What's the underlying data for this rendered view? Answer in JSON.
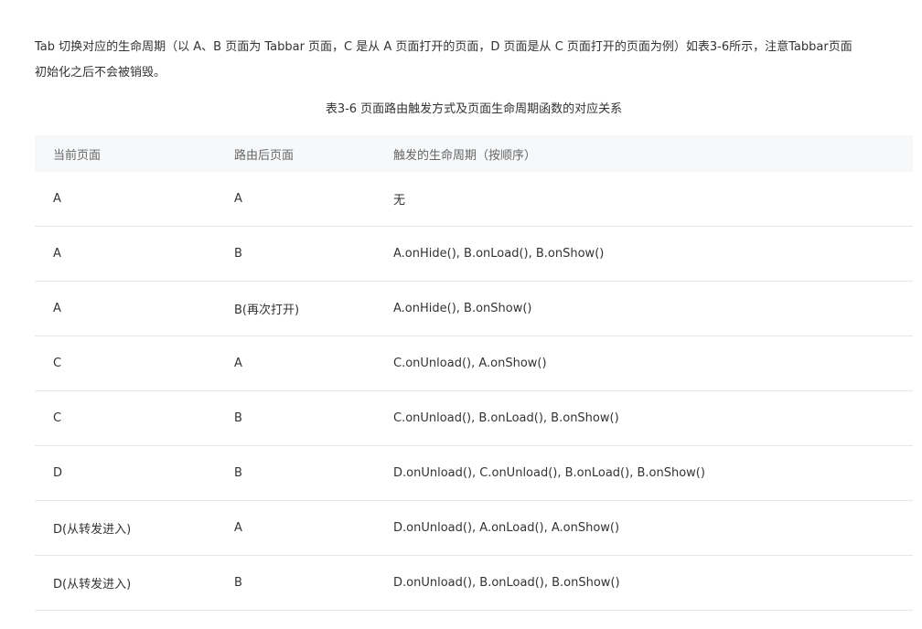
{
  "intro": {
    "line1": "Tab 切换对应的生命周期（以 A、B 页面为 Tabbar 页面，C 是从 A 页面打开的页面，D 页面是从 C 页面打开的页面为例）如表3-6所示，注意Tabbar页面",
    "line2": "初始化之后不会被销毁。"
  },
  "table": {
    "caption": "表3-6 页面路由触发方式及页面生命周期函数的对应关系",
    "headers": [
      "当前页面",
      "路由后页面",
      "触发的生命周期（按顺序）"
    ],
    "rows": [
      [
        "A",
        "A",
        "无"
      ],
      [
        "A",
        "B",
        "A.onHide(), B.onLoad(), B.onShow()"
      ],
      [
        "A",
        "B(再次打开)",
        "A.onHide(), B.onShow()"
      ],
      [
        "C",
        "A",
        "C.onUnload(), A.onShow()"
      ],
      [
        "C",
        "B",
        "C.onUnload(), B.onLoad(), B.onShow()"
      ],
      [
        "D",
        "B",
        "D.onUnload(), C.onUnload(), B.onLoad(), B.onShow()"
      ],
      [
        "D(从转发进入)",
        "A",
        "D.onUnload(), A.onLoad(), A.onShow()"
      ],
      [
        "D(从转发进入)",
        "B",
        "D.onUnload(), B.onLoad(), B.onShow()"
      ]
    ]
  }
}
